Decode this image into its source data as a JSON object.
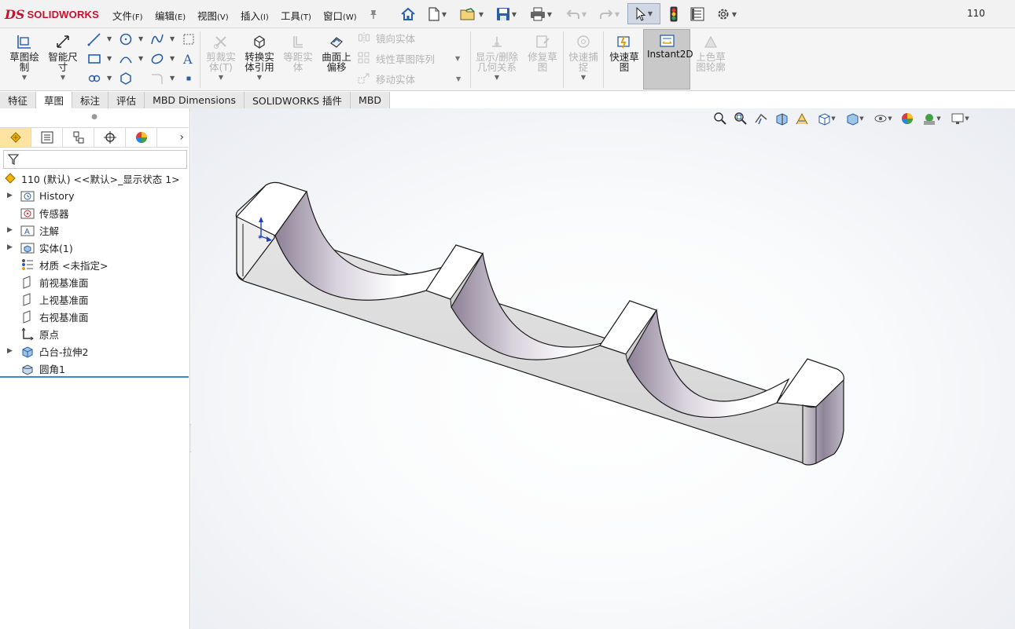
{
  "app": {
    "logo_ds": "DS",
    "logo_text": "SOLIDWORKS",
    "document_name": "110"
  },
  "menu": [
    {
      "label": "文件",
      "accel": "(F)"
    },
    {
      "label": "编辑",
      "accel": "(E)"
    },
    {
      "label": "视图",
      "accel": "(V)"
    },
    {
      "label": "插入",
      "accel": "(I)"
    },
    {
      "label": "工具",
      "accel": "(T)"
    },
    {
      "label": "窗口",
      "accel": "(W)"
    }
  ],
  "quick_access": [
    "home-icon",
    "new-document-icon",
    "open-icon",
    "save-icon",
    "print-icon",
    "undo-icon",
    "redo-icon",
    "select-icon",
    "rebuild-traffic-light-icon",
    "file-properties-icon",
    "options-gear-icon"
  ],
  "commands": {
    "sketch": "草图绘\n制",
    "smart_dimension": "智能尺\n寸",
    "trim": "剪裁实\n体(T)",
    "convert": "转换实\n体引用",
    "offset": "等距实\n体",
    "surface_offset": "曲面上\n偏移",
    "mirror": "镜向实体",
    "linear_pattern": "线性草图阵列",
    "move": "移动实体",
    "show_relations": "显示/删除\n几何关系",
    "repair": "修复草\n图",
    "quick_snaps": "快速捕\n捉",
    "rapid_sketch": "快速草\n图",
    "instant2d": "Instant2D",
    "shaded_sketch": "上色草\n图轮廓"
  },
  "tabs": [
    {
      "label": "特征",
      "active": false
    },
    {
      "label": "草图",
      "active": true
    },
    {
      "label": "标注",
      "active": false
    },
    {
      "label": "评估",
      "active": false
    },
    {
      "label": "MBD Dimensions",
      "active": false
    },
    {
      "label": "SOLIDWORKS 插件",
      "active": false
    },
    {
      "label": "MBD",
      "active": false
    }
  ],
  "panel_tabs": [
    "feature-manager-icon",
    "property-manager-icon",
    "configuration-manager-icon",
    "dimxpert-icon",
    "display-manager-icon"
  ],
  "tree": {
    "root": "110 (默认) <<默认>_显示状态 1>",
    "items": [
      {
        "label": "History",
        "expandable": true,
        "icon": "history-folder-icon"
      },
      {
        "label": "传感器",
        "expandable": false,
        "icon": "sensors-folder-icon"
      },
      {
        "label": "注解",
        "expandable": true,
        "icon": "annotations-folder-icon"
      },
      {
        "label": "实体(1)",
        "expandable": true,
        "icon": "solid-bodies-folder-icon"
      },
      {
        "label": "材质 <未指定>",
        "expandable": false,
        "icon": "material-icon"
      },
      {
        "label": "前视基准面",
        "expandable": false,
        "icon": "plane-icon"
      },
      {
        "label": "上视基准面",
        "expandable": false,
        "icon": "plane-icon"
      },
      {
        "label": "右视基准面",
        "expandable": false,
        "icon": "plane-icon"
      },
      {
        "label": "原点",
        "expandable": false,
        "icon": "origin-icon"
      },
      {
        "label": "凸台-拉伸2",
        "expandable": true,
        "icon": "boss-extrude-icon"
      },
      {
        "label": "圆角1",
        "expandable": false,
        "icon": "fillet-icon"
      }
    ]
  },
  "colors": {
    "brand_red": "#c8102e",
    "active_panel_tab": "#ffe3a3",
    "tree_end_bar": "#3a8ad1",
    "instant2d_active": "#c9c9c9"
  }
}
